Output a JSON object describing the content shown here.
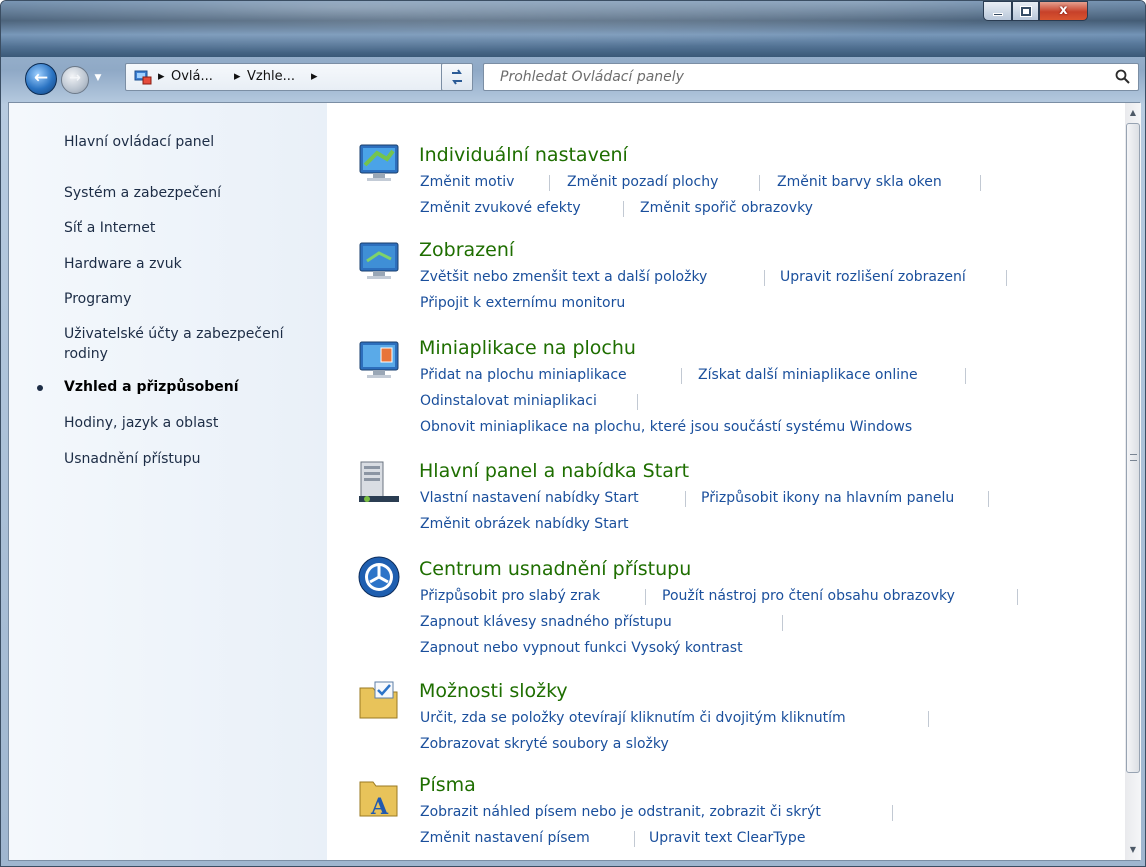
{
  "window": {
    "close_label": "x"
  },
  "address": {
    "crumbs": [
      "Ovlá...",
      "Vzhle..."
    ]
  },
  "search": {
    "placeholder": "Prohledat Ovládací panely"
  },
  "sidebar": {
    "items": [
      {
        "label": "Hlavní ovládací panel"
      },
      {
        "label": "Systém a zabezpečení"
      },
      {
        "label": "Síť a Internet"
      },
      {
        "label": "Hardware a zvuk"
      },
      {
        "label": "Programy"
      },
      {
        "label": "Uživatelské účty a zabezpečení rodiny"
      },
      {
        "label": "Vzhled a přizpůsobení"
      },
      {
        "label": "Hodiny, jazyk a oblast"
      },
      {
        "label": "Usnadnění přístupu"
      }
    ]
  },
  "categories": [
    {
      "title": "Individuální nastavení",
      "links": [
        "Změnit motiv",
        "Změnit pozadí plochy",
        "Změnit barvy skla oken",
        "Změnit zvukové efekty",
        "Změnit spořič obrazovky"
      ]
    },
    {
      "title": "Zobrazení",
      "links": [
        "Zvětšit nebo zmenšit text a další položky",
        "Upravit rozlišení zobrazení",
        "Připojit k externímu monitoru"
      ]
    },
    {
      "title": "Miniaplikace na plochu",
      "links": [
        "Přidat na plochu miniaplikace",
        "Získat další miniaplikace online",
        "Odinstalovat miniaplikaci",
        "Obnovit miniaplikace na plochu, které jsou součástí systému Windows"
      ]
    },
    {
      "title": "Hlavní panel a nabídka Start",
      "links": [
        "Vlastní nastavení nabídky Start",
        "Přizpůsobit ikony na hlavním panelu",
        "Změnit obrázek nabídky Start"
      ]
    },
    {
      "title": "Centrum usnadnění přístupu",
      "links": [
        "Přizpůsobit pro slabý zrak",
        "Použít nástroj pro čtení obsahu obrazovky",
        "Zapnout klávesy snadného přístupu",
        "Zapnout nebo vypnout funkci Vysoký kontrast"
      ]
    },
    {
      "title": "Možnosti složky",
      "links": [
        "Určit, zda se položky otevírají kliknutím či dvojitým kliknutím",
        "Zobrazovat skryté soubory a složky"
      ]
    },
    {
      "title": "Písma",
      "links": [
        "Zobrazit náhled písem nebo je odstranit, zobrazit či skrýt",
        "Změnit nastavení písem",
        "Upravit text ClearType"
      ]
    }
  ]
}
